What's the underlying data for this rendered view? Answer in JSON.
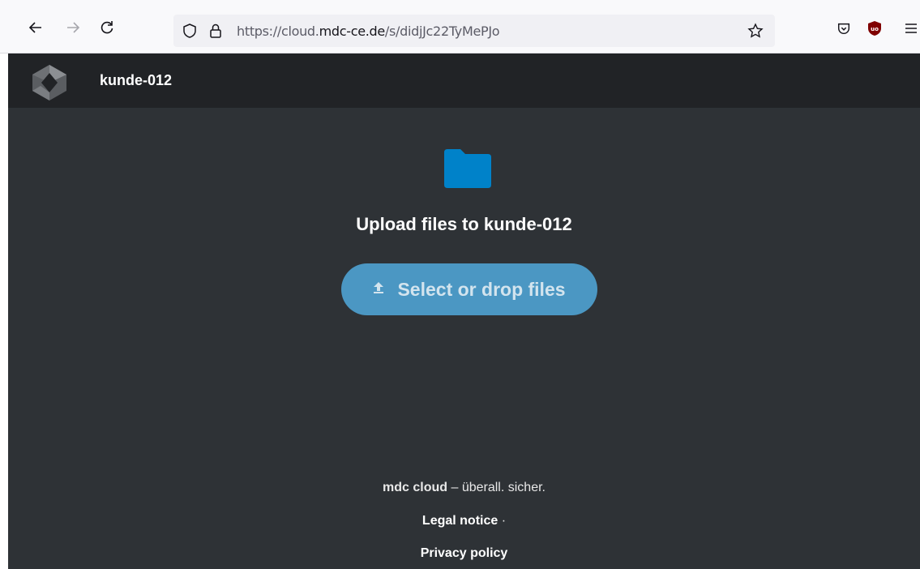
{
  "browser": {
    "url_prefix": "https://cloud.",
    "url_host": "mdc-ce.de",
    "url_path": "/s/didjJc22TyMePJo"
  },
  "header": {
    "title": "kunde-012"
  },
  "main": {
    "upload_title": "Upload files to kunde-012",
    "upload_button_label": "Select or drop files",
    "upload_icon": "upload-icon",
    "folder_icon": "folder-icon",
    "accent_color": "#0082c9"
  },
  "footer": {
    "brand": "mdc cloud",
    "slogan": " – überall. sicher.",
    "legal_label": "Legal notice",
    "separator": " ·",
    "privacy_label": "Privacy policy"
  }
}
